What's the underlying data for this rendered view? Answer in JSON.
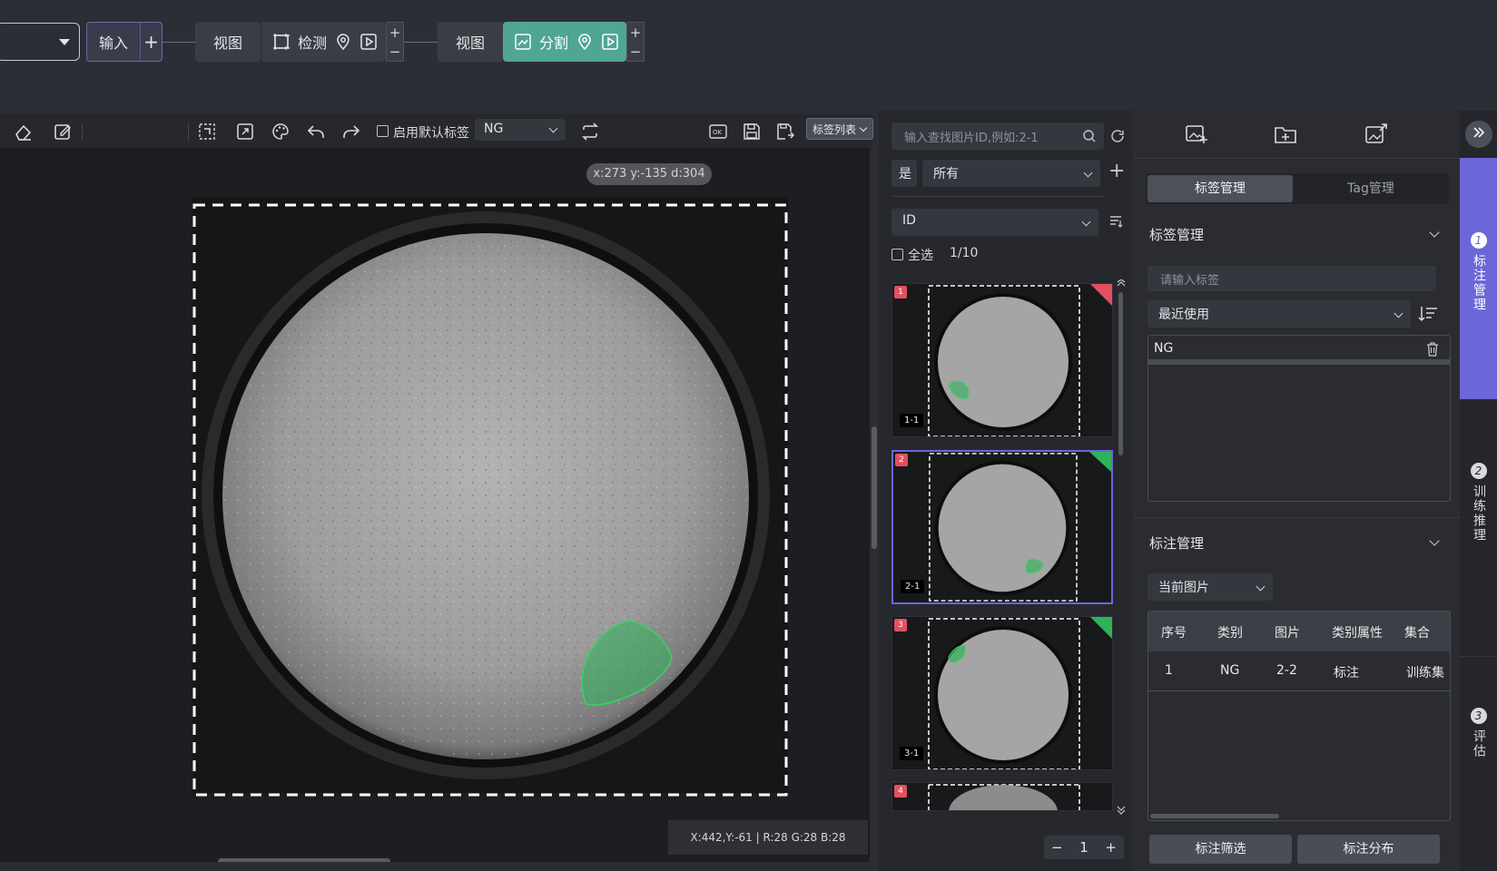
{
  "pipeline": {
    "input_label": "输入",
    "input_plus": "+",
    "view1_label": "视图",
    "detect_label": "检测",
    "view2_label": "视图",
    "segment_label": "分割",
    "plus": "+",
    "minus": "−"
  },
  "toolbar": {
    "default_tag_checkbox_label": "启用默认标签",
    "default_tag_value": "NG",
    "tag_list_button": "标签列表"
  },
  "canvas": {
    "coord_bubble": "x:273 y:-135 d:304",
    "status": "X:442,Y:-61 | R:28 G:28 B:28"
  },
  "image_list": {
    "search_placeholder": "输入查找图片ID,例如:2-1",
    "filter_prefix": "是",
    "filter_value": "所有",
    "sort_value": "ID",
    "select_all_label": "全选",
    "count": "1/10",
    "items": [
      {
        "num": "1",
        "id": "1-1",
        "corner": "#e25060"
      },
      {
        "num": "2",
        "id": "2-1",
        "corner": "#2fb35a"
      },
      {
        "num": "3",
        "id": "3-1",
        "corner": "#2fb35a"
      },
      {
        "num": "4",
        "id": "",
        "corner": ""
      }
    ],
    "page": "1",
    "page_minus": "−",
    "page_plus": "+"
  },
  "right_panel": {
    "tabs": [
      "标签管理",
      "Tag管理"
    ],
    "label_section_title": "标签管理",
    "label_input_placeholder": "请输入标签",
    "recent_select": "最近使用",
    "tags": [
      "NG"
    ],
    "annot_section_title": "标注管理",
    "scope_select": "当前图片",
    "table_headers": [
      "序号",
      "类别",
      "图片",
      "类别属性",
      "集合"
    ],
    "table_rows": [
      [
        "1",
        "NG",
        "2-2",
        "标注",
        "训练集"
      ]
    ],
    "filter_button": "标注筛选",
    "distribution_button": "标注分布"
  },
  "steps": [
    {
      "num": "1",
      "label": "标注管理",
      "active": true
    },
    {
      "num": "2",
      "label": "训练推理",
      "active": false
    },
    {
      "num": "3",
      "label": "评估",
      "active": false
    }
  ],
  "colors": {
    "segment_node": "#4fa694",
    "accent": "#6b67d8",
    "mask_green": "#2fb35a",
    "ng_red": "#e25060"
  }
}
